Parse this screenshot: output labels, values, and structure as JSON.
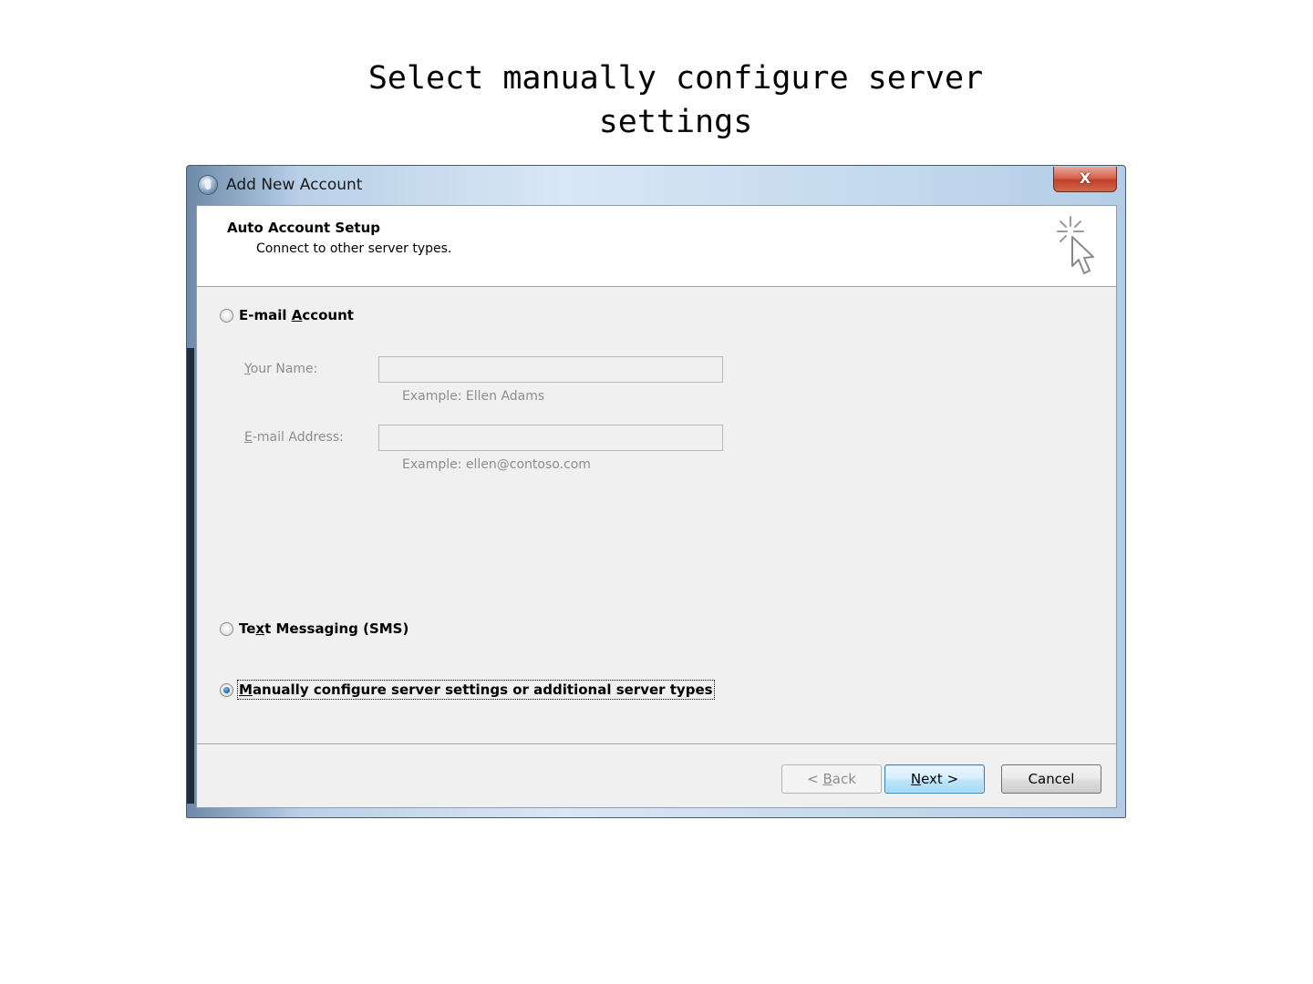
{
  "slide": {
    "title_line1": "Select manually configure server",
    "title_line2": "settings"
  },
  "window": {
    "title": "Add New Account",
    "close_label": "X"
  },
  "header": {
    "title": "Auto Account Setup",
    "subtitle": "Connect to other server types."
  },
  "options": {
    "email_account": {
      "label_pre": "E-mail ",
      "label_u": "A",
      "label_post": "ccount",
      "checked": false
    },
    "text_messaging": {
      "label_pre": "Te",
      "label_u": "x",
      "label_post": "t Messaging (SMS)",
      "checked": false
    },
    "manual_config": {
      "label_pre": "",
      "label_u": "M",
      "label_post": "anually configure server settings or additional server types",
      "checked": true
    }
  },
  "fields": {
    "name": {
      "label_u": "Y",
      "label_post": "our Name:",
      "value": "",
      "example": "Example: Ellen Adams"
    },
    "email": {
      "label_u": "E",
      "label_post": "-mail Address:",
      "value": "",
      "example": "Example: ellen@contoso.com"
    }
  },
  "buttons": {
    "back_pre": "< ",
    "back_u": "B",
    "back_post": "ack",
    "next_u": "N",
    "next_post": "ext >",
    "cancel": "Cancel"
  },
  "icons": {
    "app": "outlook-app-icon",
    "header": "cursor-sparkle-icon",
    "close": "close-icon"
  }
}
